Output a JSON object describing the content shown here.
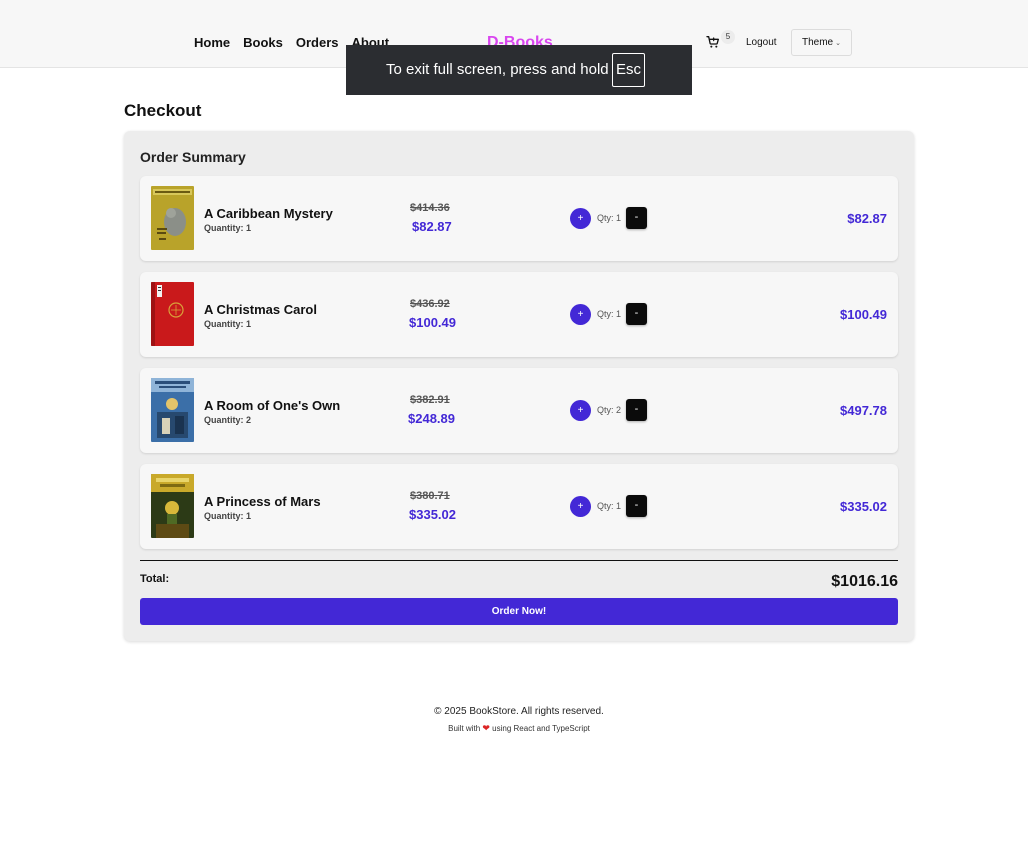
{
  "nav": {
    "links": [
      "Home",
      "Books",
      "Orders",
      "About"
    ],
    "brand": "D-Books",
    "cart_count": "5",
    "logout": "Logout",
    "theme": "Theme"
  },
  "fullscreen_toast": {
    "message": "To exit full screen, press and hold",
    "key": "Esc"
  },
  "checkout": {
    "title": "Checkout",
    "summary_title": "Order Summary",
    "items": [
      {
        "title": "A Caribbean Mystery",
        "quantity_label": "Quantity: 1",
        "old_price": "$414.36",
        "price": "$82.87",
        "plus": "+",
        "qty": "Qty: 1",
        "minus": "-",
        "line_total": "$82.87"
      },
      {
        "title": "A Christmas Carol",
        "quantity_label": "Quantity: 1",
        "old_price": "$436.92",
        "price": "$100.49",
        "plus": "+",
        "qty": "Qty: 1",
        "minus": "-",
        "line_total": "$100.49"
      },
      {
        "title": "A Room of One's Own",
        "quantity_label": "Quantity: 2",
        "old_price": "$382.91",
        "price": "$248.89",
        "plus": "+",
        "qty": "Qty: 2",
        "minus": "-",
        "line_total": "$497.78"
      },
      {
        "title": "A Princess of Mars",
        "quantity_label": "Quantity: 1",
        "old_price": "$380.71",
        "price": "$335.02",
        "plus": "+",
        "qty": "Qty: 1",
        "minus": "-",
        "line_total": "$335.02"
      }
    ],
    "total_label": "Total:",
    "total_value": "$1016.16",
    "order_button": "Order Now!"
  },
  "footer": {
    "copyright": "© 2025 BookStore. All rights reserved.",
    "built_with_prefix": "Built with",
    "built_with_suffix": "using React and TypeScript"
  },
  "colors": {
    "accent": "#4328d6",
    "brand": "#d946ef"
  }
}
